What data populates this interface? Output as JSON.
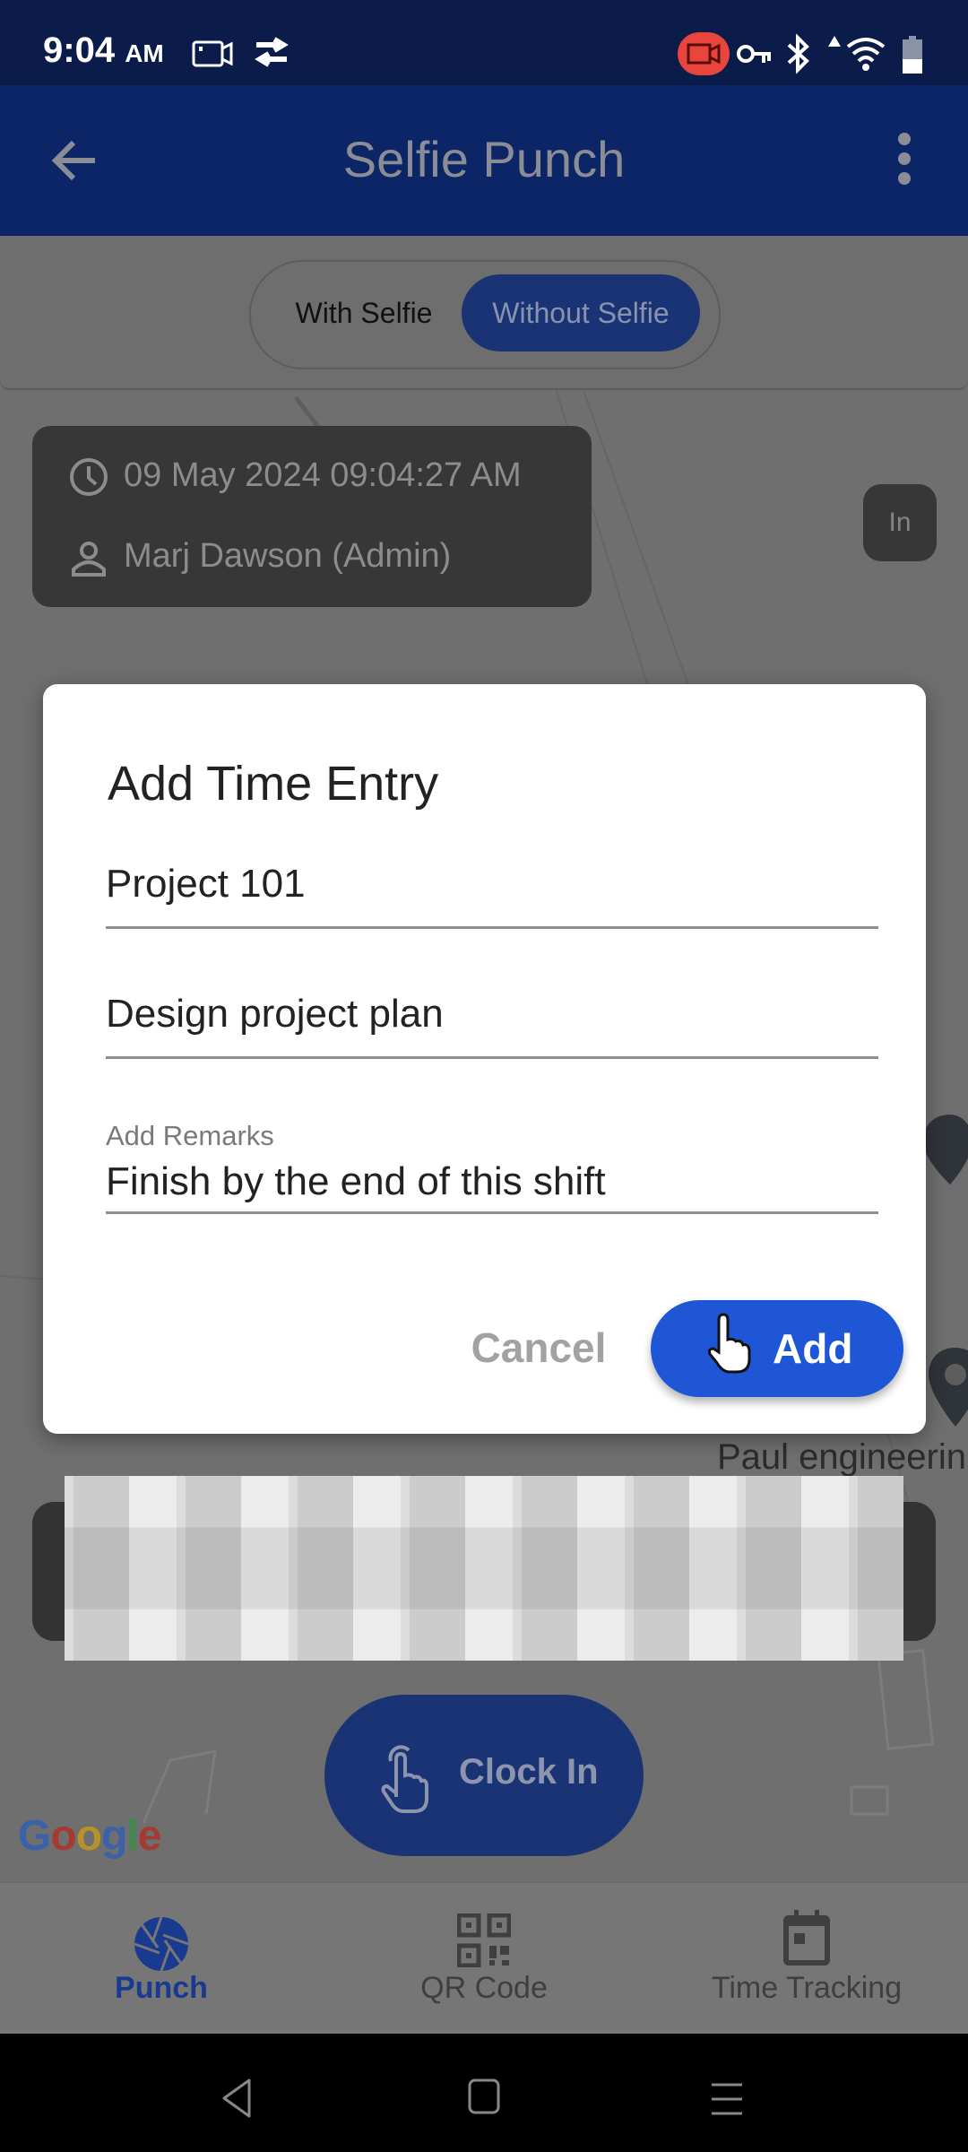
{
  "status_bar": {
    "time": "9:04",
    "ampm": "AM",
    "left_icons": [
      "screen-record-icon",
      "sync-icon"
    ],
    "right_icons": [
      "camera-recording-icon",
      "vpn-key-icon",
      "bluetooth-icon",
      "signal-icon",
      "wifi-icon",
      "battery-icon"
    ]
  },
  "app_bar": {
    "title": "Selfie Punch",
    "back_icon": "arrow-left-icon",
    "menu_icon": "more-vertical-icon"
  },
  "mode_toggle": {
    "options": [
      "With Selfie",
      "Without Selfie"
    ],
    "selected": "Without Selfie"
  },
  "info_card": {
    "datetime": "09 May 2024 09:04:27 AM",
    "user": "Marj Dawson (Admin)"
  },
  "status_pill": "In",
  "map": {
    "place_label": "Paul engineerin",
    "attribution": "Google"
  },
  "clock_button": {
    "label": "Clock In",
    "icon": "touch-hand-icon"
  },
  "dialog": {
    "title": "Add Time Entry",
    "project_value": "Project 101",
    "task_value": "Design project plan",
    "remarks_label": "Add Remarks",
    "remarks_value": "Finish by the end of this shift",
    "cancel_label": "Cancel",
    "add_label": "Add"
  },
  "bottom_nav": {
    "items": [
      {
        "label": "Punch",
        "icon": "camera-shutter-icon",
        "active": true
      },
      {
        "label": "QR Code",
        "icon": "qr-code-icon",
        "active": false
      },
      {
        "label": "Time Tracking",
        "icon": "calendar-icon",
        "active": false
      }
    ]
  },
  "colors": {
    "primary": "#0c2566",
    "accent_button": "#1e56d6",
    "active_nav": "#1a3a8f",
    "scrim": "#6f6f6f"
  }
}
